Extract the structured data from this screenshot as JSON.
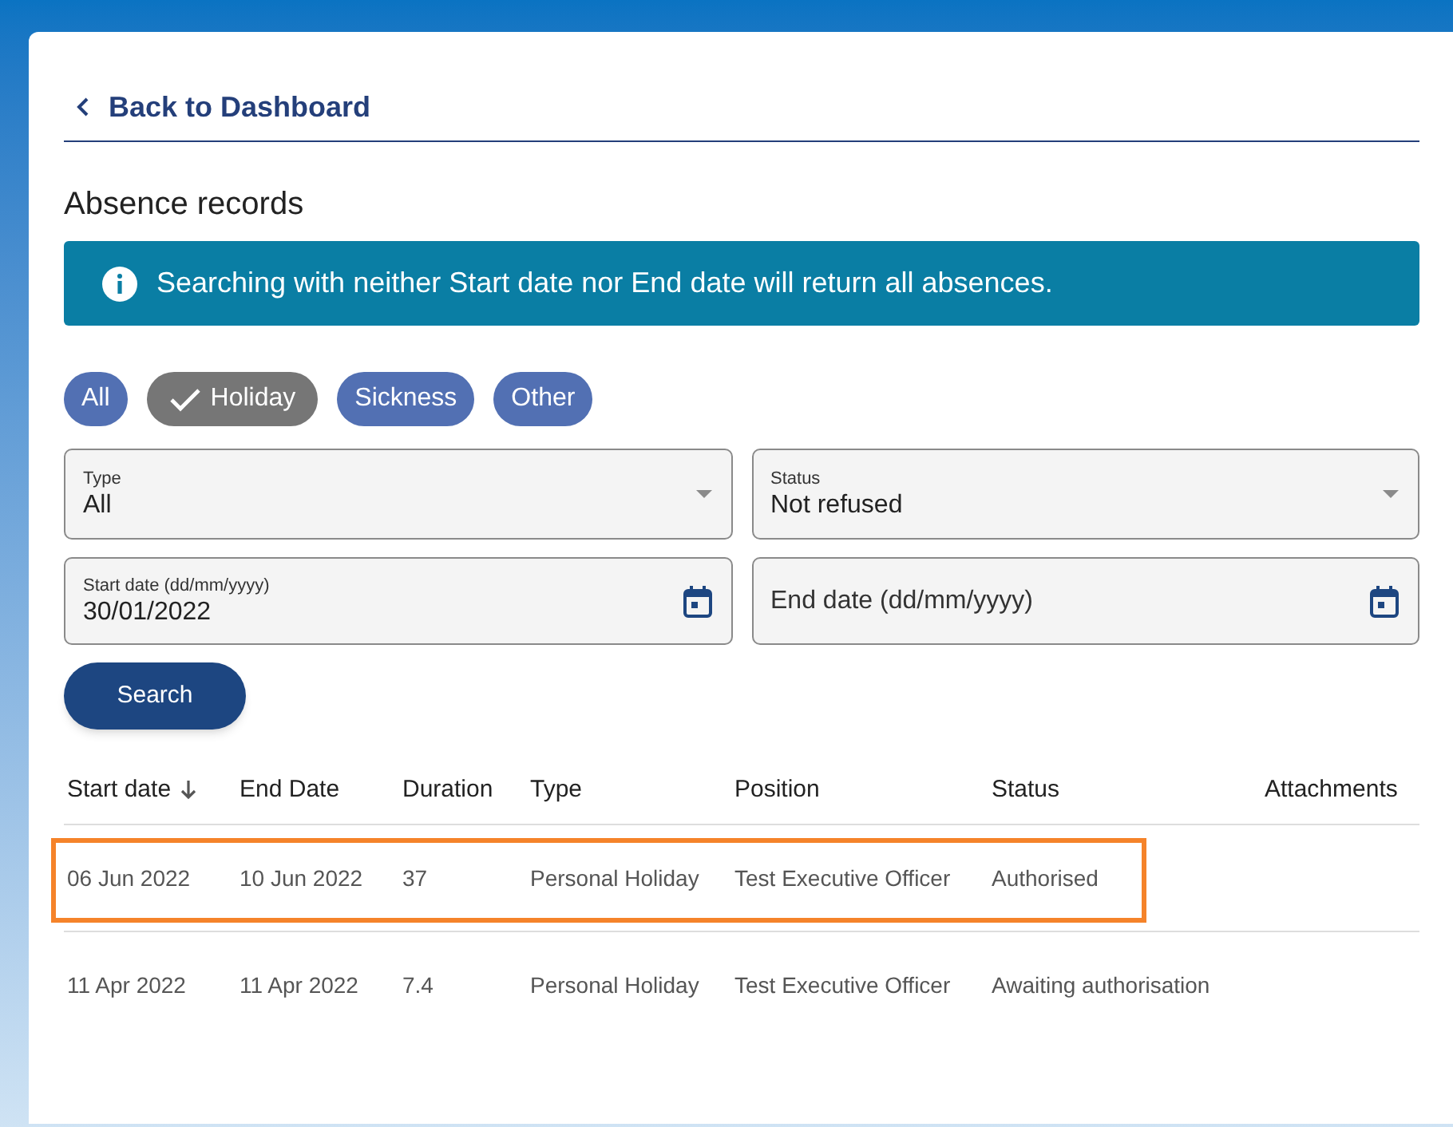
{
  "back_link": {
    "label": "Back to Dashboard"
  },
  "page_title": "Absence records",
  "info_banner": {
    "text": "Searching with neither Start date nor End date will return all absences."
  },
  "filter_chips": [
    {
      "label": "All",
      "selected": false
    },
    {
      "label": "Holiday",
      "selected": true
    },
    {
      "label": "Sickness",
      "selected": false
    },
    {
      "label": "Other",
      "selected": false
    }
  ],
  "fields": [
    {
      "kind": "select",
      "label": "Type",
      "value": "All"
    },
    {
      "kind": "select",
      "label": "Status",
      "value": "Not refused"
    },
    {
      "kind": "date",
      "label": "Start date (dd/mm/yyyy)",
      "value": "30/01/2022"
    },
    {
      "kind": "date",
      "placeholder": "End date (dd/mm/yyyy)"
    }
  ],
  "search_button": {
    "label": "Search"
  },
  "table": {
    "columns": [
      {
        "label": "Start date",
        "sorted": true
      },
      {
        "label": "End Date",
        "sorted": false
      },
      {
        "label": "Duration",
        "sorted": false
      },
      {
        "label": "Type",
        "sorted": false
      },
      {
        "label": "Position",
        "sorted": false
      },
      {
        "label": "Status",
        "sorted": false
      },
      {
        "label": "Attachments",
        "sorted": false
      }
    ],
    "rows": [
      {
        "highlighted": true,
        "cells": [
          "06 Jun 2022",
          "10 Jun 2022",
          "37",
          "Personal Holiday",
          "Test Executive Officer",
          "Authorised"
        ]
      },
      {
        "highlighted": false,
        "cells": [
          "11 Apr 2022",
          "11 Apr 2022",
          "7.4",
          "Personal Holiday",
          "Test Executive Officer",
          "Awaiting authorisation"
        ]
      }
    ]
  }
}
